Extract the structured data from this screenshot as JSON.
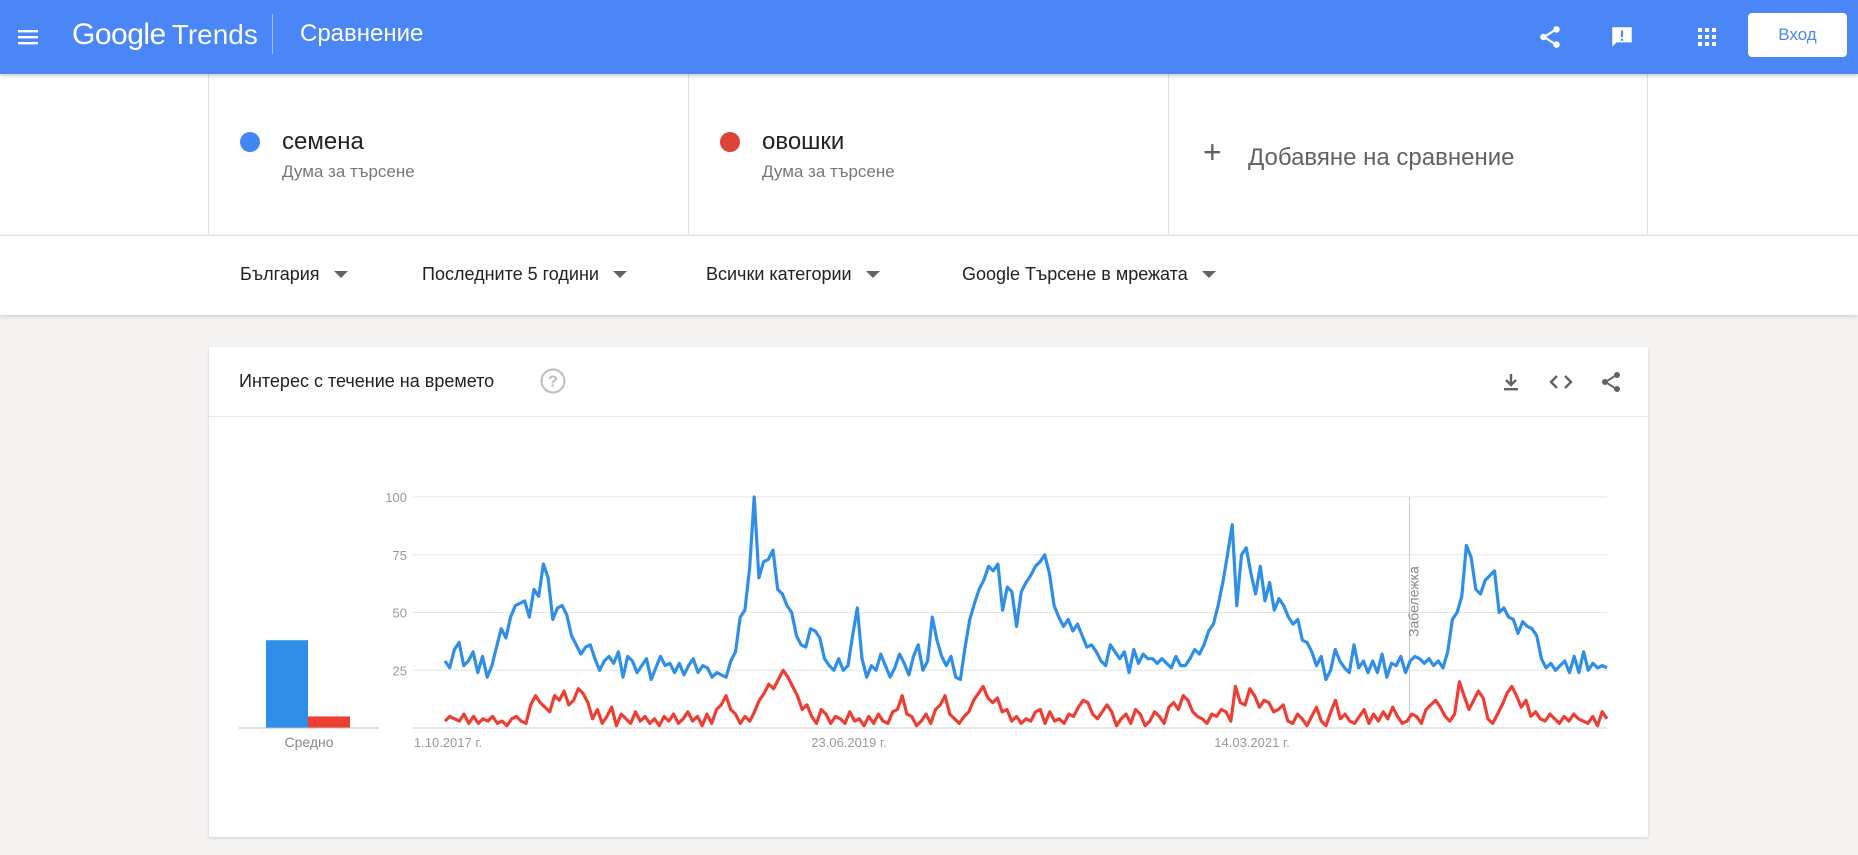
{
  "header": {
    "brand_google": "Google",
    "brand_trends": "Trends",
    "page_title": "Сравнение",
    "signin_label": "Вход",
    "accent": "#4a86f5"
  },
  "terms": [
    {
      "name": "семена",
      "type": "Дума за търсене",
      "color": "#4285f4"
    },
    {
      "name": "овошки",
      "type": "Дума за търсене",
      "color": "#db4437"
    }
  ],
  "add_compare": {
    "plus": "+",
    "label": "Добавяне на сравнение"
  },
  "filters": {
    "region": "България",
    "period": "Последните 5 години",
    "category": "Всички категории",
    "property": "Google Търсене в мрежата"
  },
  "card": {
    "title": "Интерес с течение на времето",
    "avg_label": "Средно",
    "note_label": "Забележка",
    "icons": [
      "help-icon",
      "download-icon",
      "embed-icon",
      "share-icon"
    ]
  },
  "chart_data": {
    "type": "line",
    "x_ticks": [
      "1.10.2017 г.",
      "23.06.2019 г.",
      "14.03.2021 г."
    ],
    "y_ticks": [
      25,
      50,
      75,
      100
    ],
    "ylim": [
      0,
      100
    ],
    "grid": true,
    "note_position": 0.83,
    "averages": [
      {
        "name": "семена",
        "value": 38,
        "color": "#2f8fe8"
      },
      {
        "name": "овошки",
        "value": 5,
        "color": "#ee3e33"
      }
    ],
    "series": [
      {
        "name": "семена",
        "color": "#2f8fe8",
        "values": [
          29,
          26,
          34,
          37,
          27,
          29,
          33,
          24,
          31,
          22,
          27,
          35,
          43,
          39,
          48,
          53,
          54,
          55,
          48,
          60,
          57,
          71,
          65,
          47,
          52,
          53,
          49,
          40,
          36,
          32,
          35,
          36,
          30,
          25,
          29,
          31,
          28,
          33,
          22,
          31,
          29,
          24,
          27,
          30,
          21,
          26,
          31,
          27,
          28,
          24,
          28,
          23,
          27,
          30,
          24,
          27,
          26,
          22,
          24,
          23,
          22,
          29,
          33,
          48,
          51,
          69,
          100,
          65,
          72,
          73,
          77,
          60,
          58,
          53,
          50,
          40,
          36,
          35,
          43,
          42,
          39,
          30,
          27,
          25,
          30,
          25,
          27,
          40,
          52,
          30,
          22,
          27,
          25,
          32,
          27,
          22,
          26,
          32,
          28,
          23,
          31,
          36,
          25,
          29,
          48,
          38,
          31,
          27,
          31,
          22,
          21,
          35,
          47,
          54,
          60,
          64,
          70,
          68,
          71,
          51,
          61,
          59,
          44,
          59,
          63,
          66,
          70,
          72,
          75,
          67,
          53,
          48,
          44,
          47,
          42,
          45,
          40,
          35,
          36,
          33,
          29,
          27,
          36,
          33,
          30,
          33,
          24,
          34,
          28,
          32,
          30,
          30,
          28,
          30,
          28,
          26,
          31,
          27,
          27,
          30,
          34,
          32,
          36,
          42,
          45,
          53,
          63,
          75,
          88,
          53,
          75,
          78,
          67,
          58,
          70,
          55,
          63,
          51,
          56,
          53,
          48,
          45,
          47,
          38,
          37,
          33,
          27,
          31,
          21,
          25,
          34,
          29,
          26,
          24,
          36,
          26,
          29,
          24,
          29,
          24,
          32,
          22,
          28,
          27,
          31,
          24,
          29,
          31,
          30,
          28,
          30,
          27,
          29,
          26,
          33,
          47,
          50,
          57,
          79,
          74,
          60,
          58,
          64,
          66,
          68,
          50,
          52,
          48,
          47,
          41,
          46,
          44,
          43,
          40,
          30,
          26,
          28,
          25,
          27,
          29,
          24,
          31,
          24,
          33,
          25,
          28,
          26,
          27,
          26
        ]
      },
      {
        "name": "овошки",
        "color": "#ee3e33",
        "values": [
          3,
          5,
          4,
          3,
          6,
          2,
          5,
          2,
          4,
          3,
          5,
          2,
          3,
          1,
          4,
          5,
          3,
          2,
          10,
          14,
          11,
          9,
          7,
          14,
          12,
          16,
          10,
          12,
          17,
          15,
          11,
          4,
          8,
          2,
          5,
          9,
          1,
          6,
          4,
          2,
          7,
          3,
          5,
          2,
          4,
          1,
          5,
          3,
          6,
          2,
          4,
          7,
          3,
          5,
          1,
          6,
          2,
          8,
          10,
          14,
          8,
          6,
          2,
          5,
          3,
          7,
          12,
          15,
          19,
          17,
          21,
          25,
          22,
          18,
          14,
          8,
          10,
          5,
          2,
          8,
          6,
          2,
          5,
          4,
          2,
          7,
          3,
          4,
          1,
          5,
          2,
          6,
          3,
          2,
          7,
          8,
          14,
          6,
          5,
          1,
          3,
          6,
          2,
          8,
          10,
          14,
          6,
          4,
          2,
          5,
          7,
          12,
          15,
          18,
          13,
          11,
          13,
          7,
          8,
          3,
          5,
          2,
          4,
          3,
          7,
          8,
          2,
          7,
          3,
          4,
          2,
          6,
          5,
          9,
          12,
          11,
          6,
          4,
          7,
          10,
          7,
          1,
          4,
          6,
          2,
          8,
          6,
          1,
          3,
          7,
          5,
          2,
          9,
          11,
          8,
          14,
          12,
          7,
          5,
          4,
          2,
          6,
          5,
          8,
          7,
          3,
          18,
          11,
          10,
          17,
          14,
          9,
          12,
          11,
          7,
          8,
          10,
          3,
          2,
          6,
          4,
          1,
          5,
          9,
          3,
          1,
          7,
          12,
          4,
          6,
          3,
          2,
          5,
          8,
          2,
          6,
          3,
          7,
          4,
          9,
          5,
          2,
          3,
          6,
          5,
          2,
          8,
          10,
          12,
          9,
          5,
          3,
          6,
          20,
          14,
          8,
          12,
          16,
          13,
          4,
          2,
          6,
          10,
          15,
          18,
          14,
          9,
          12,
          5,
          7,
          4,
          3,
          6,
          4,
          2,
          5,
          3,
          6,
          4,
          3,
          2,
          5,
          1,
          7,
          4
        ]
      }
    ]
  }
}
